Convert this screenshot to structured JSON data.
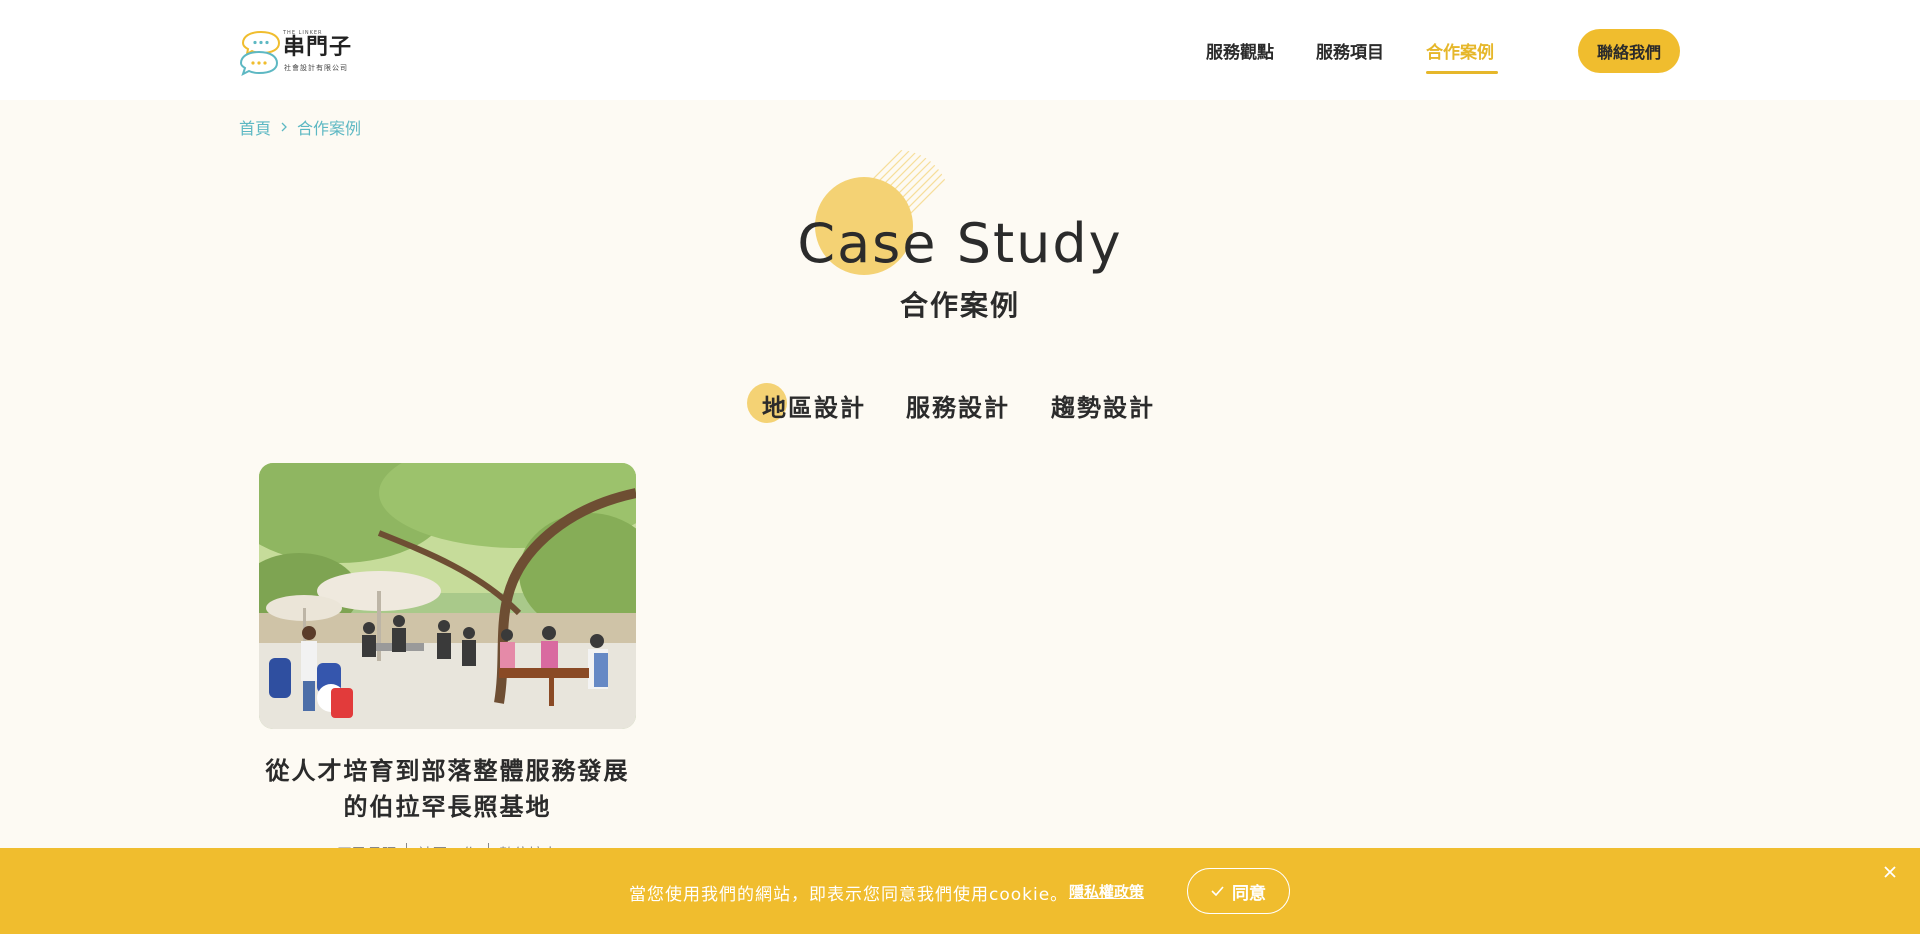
{
  "header": {
    "logo": {
      "tagline": "THE LINKER",
      "name": "串門子",
      "subtitle": "社會設計有限公司"
    },
    "nav": [
      {
        "label": "服務觀點"
      },
      {
        "label": "服務項目"
      },
      {
        "label": "合作案例",
        "active": true
      }
    ],
    "contact_label": "聯絡我們"
  },
  "breadcrumb": {
    "home": "首頁",
    "current": "合作案例"
  },
  "hero": {
    "title": "Case Study",
    "subtitle": "合作案例"
  },
  "tabs": [
    {
      "label": "地區設計",
      "active": true
    },
    {
      "label": "服務設計"
    },
    {
      "label": "趨勢設計"
    }
  ],
  "cards": [
    {
      "title_line1": "從人才培育到部落整體服務發展",
      "title_line2": "的伯拉罕長照基地",
      "tags": [
        "原民長照",
        "社區工作",
        "數位培力"
      ]
    }
  ],
  "cookie": {
    "text": "當您使用我們的網站，即表示您同意我們使用cookie。",
    "policy_label": "隱私權政策",
    "agree_label": "同意"
  },
  "colors": {
    "accent": "#f0bd2e",
    "link": "#5db8c3",
    "background": "#fdfaf3",
    "text": "#2b2b2b"
  }
}
